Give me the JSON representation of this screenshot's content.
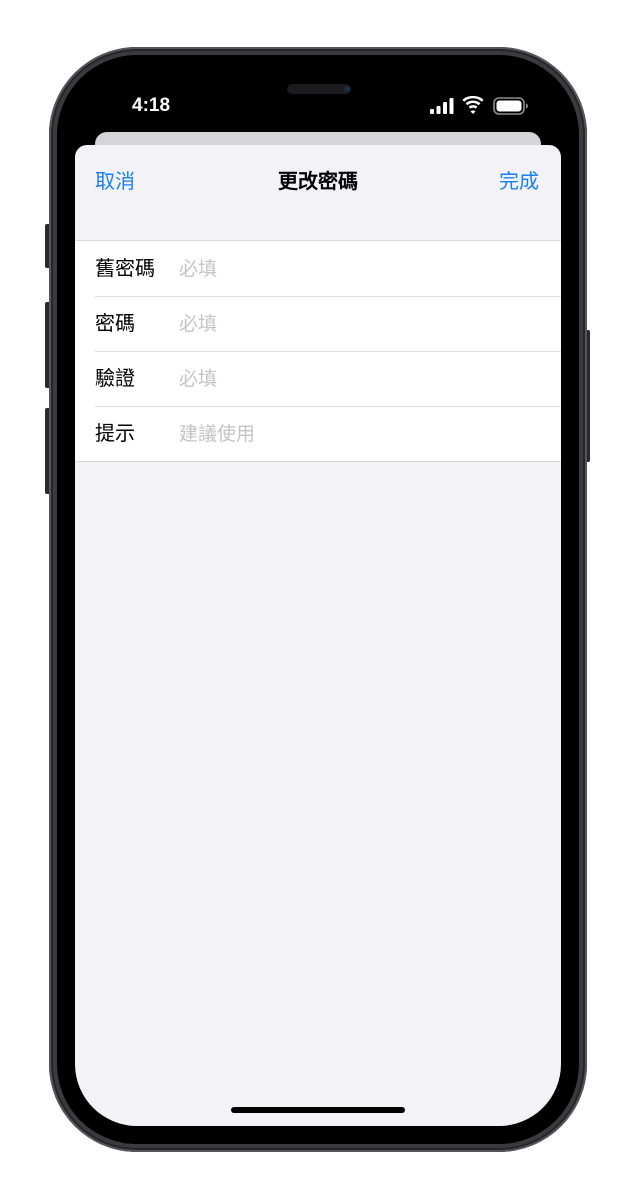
{
  "status_bar": {
    "time": "4:18",
    "icons": [
      "cellular-signal-icon",
      "wifi-icon",
      "battery-icon"
    ]
  },
  "nav": {
    "cancel_label": "取消",
    "title": "更改密碼",
    "done_label": "完成"
  },
  "form": {
    "rows": [
      {
        "label": "舊密碼",
        "placeholder": "必填"
      },
      {
        "label": "密碼",
        "placeholder": "必填"
      },
      {
        "label": "驗證",
        "placeholder": "必填"
      },
      {
        "label": "提示",
        "placeholder": "建議使用"
      }
    ]
  },
  "colors": {
    "accent": "#1a7ff5",
    "sheet_background": "#f2f2f7",
    "placeholder": "#c4c4c7"
  }
}
